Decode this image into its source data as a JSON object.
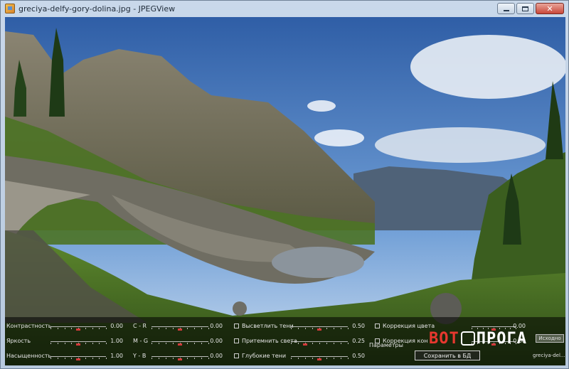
{
  "window": {
    "title": "greciya-delfy-gory-dolina.jpg - JPEGView",
    "icons": {
      "app": "jpegview-app-icon",
      "minimize": "minimize-icon",
      "maximize": "maximize-icon",
      "close": "close-icon"
    },
    "close_glyph": "✕"
  },
  "panel": {
    "rows": [
      {
        "label": "Контрастность",
        "value": "0.00",
        "level": 0.5,
        "mid_label": "C - R",
        "mid_value": "0.00",
        "mid_level": 0.5
      },
      {
        "label": "Яркость",
        "value": "1.00",
        "level": 0.5,
        "mid_label": "M - G",
        "mid_value": "0.00",
        "mid_level": 0.5
      },
      {
        "label": "Насыщенность",
        "value": "1.00",
        "level": 0.5,
        "mid_label": "Y - B",
        "mid_value": "0.00",
        "mid_level": 0.5
      }
    ],
    "checks": [
      {
        "label": "Высветлить тени",
        "value": "0.50",
        "level": 0.5
      },
      {
        "label": "Притемнить света",
        "value": "0.25",
        "level": 0.25
      },
      {
        "label": "Глубокие тени",
        "value": "0.50",
        "level": 0.5
      }
    ],
    "right_checks": [
      {
        "label": "Коррекция цвета",
        "value": "0.00"
      },
      {
        "label": "Коррекция кон",
        "value": "0.50"
      }
    ],
    "params_label": "Параметры",
    "save_button": "Сохранить в БД",
    "small_button": "Исходно",
    "filename": "greciya-del..."
  },
  "watermark": {
    "part1": "ВОТ",
    "part2": "ПРОГА",
    "icon": "thumbs-up-icon"
  },
  "colors": {
    "panel_bg": "#000000",
    "slider_thumb": "#d23a3a",
    "accent": "#e8382f"
  }
}
